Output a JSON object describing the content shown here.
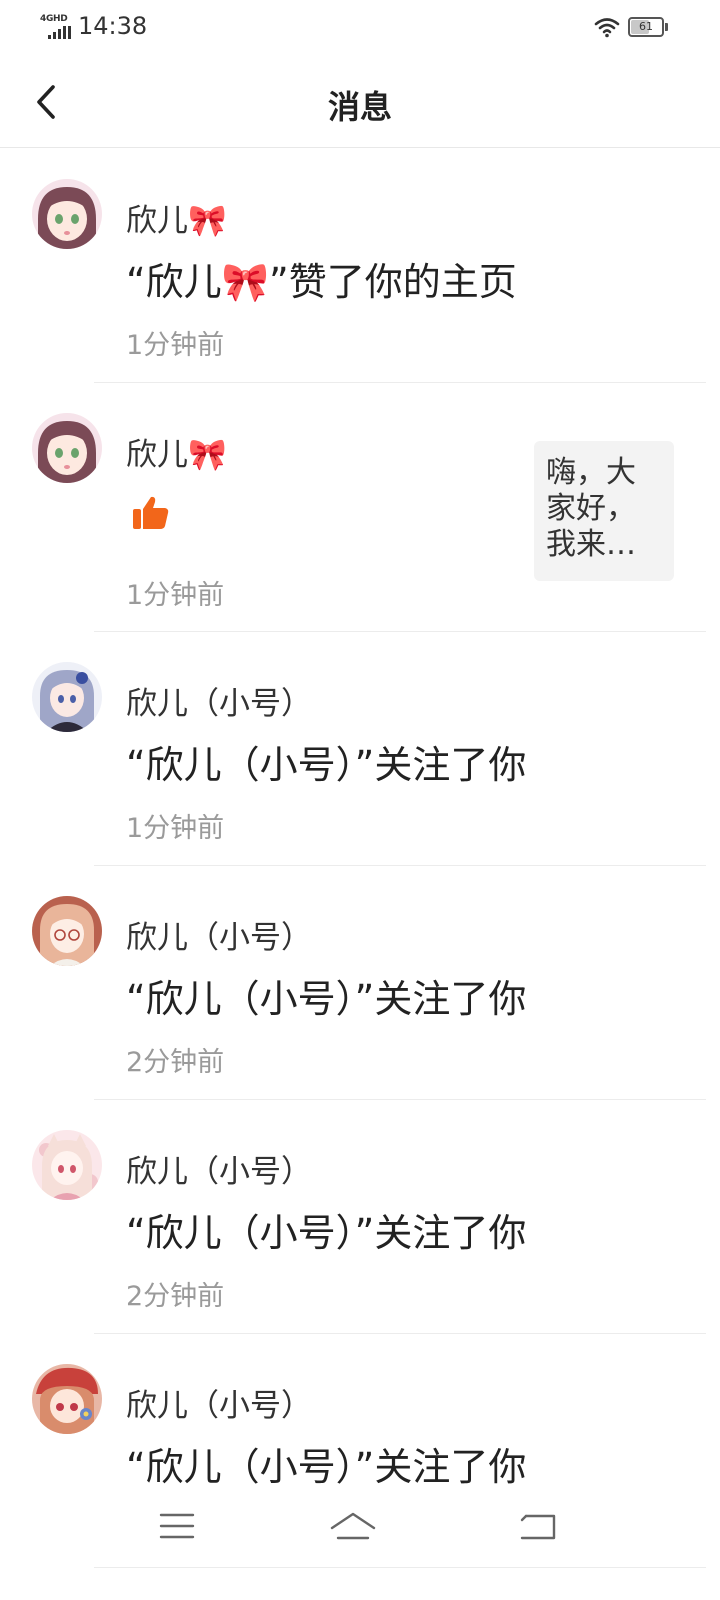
{
  "status_bar": {
    "network": "4GHD",
    "time": "14:38",
    "battery_level": "61",
    "battery_fraction": 0.61
  },
  "header": {
    "title": "消息"
  },
  "messages": [
    {
      "name": "欣儿🎀",
      "text": "“欣儿🎀”赞了你的主页",
      "time": "1分钟前",
      "type": "like-profile",
      "avatar_tone": "#b07a8e"
    },
    {
      "name": "欣儿🎀",
      "text": "",
      "time": "1分钟前",
      "type": "like-post",
      "preview": "嗨，大家好，我来…",
      "avatar_tone": "#b07a8e"
    },
    {
      "name": "欣儿（小号）",
      "text": "“欣儿（小号）”关注了你",
      "time": "1分钟前",
      "type": "follow",
      "avatar_tone": "#6d6a8c"
    },
    {
      "name": "欣儿（小号）",
      "text": "“欣儿（小号）”关注了你",
      "time": "2分钟前",
      "type": "follow",
      "avatar_tone": "#d29a86"
    },
    {
      "name": "欣儿（小号）",
      "text": "“欣儿（小号）”关注了你",
      "time": "2分钟前",
      "type": "follow",
      "avatar_tone": "#e7b2b8"
    },
    {
      "name": "欣儿（小号）",
      "text": "“欣儿（小号）”关注了你",
      "time": "",
      "type": "follow",
      "avatar_tone": "#c9735f"
    }
  ],
  "icons": {
    "like": "thumbs-up-icon",
    "back": "chevron-left-icon",
    "menu": "menu-icon",
    "home": "home-icon",
    "return": "return-icon"
  },
  "colors": {
    "like": "#f2661a",
    "time_text": "#9a9a9a",
    "preview_bg": "#f3f3f3"
  }
}
